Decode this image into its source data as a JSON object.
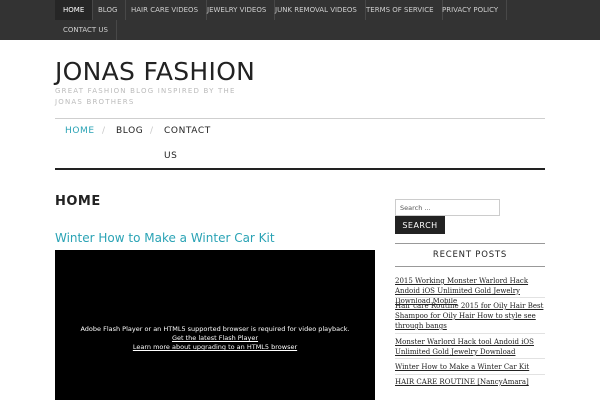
{
  "topnav": {
    "items": [
      {
        "label": "HOME",
        "active": true
      },
      {
        "label": "BLOG"
      },
      {
        "label": "HAIR CARE VIDEOS"
      },
      {
        "label": "JEWELRY VIDEOS"
      },
      {
        "label": "JUNK REMOVAL VIDEOS"
      },
      {
        "label": "TERMS OF SERVICE"
      },
      {
        "label": "PRIVACY POLICY"
      },
      {
        "label": "CONTACT US"
      }
    ]
  },
  "header": {
    "title": "JONAS FASHION",
    "description": "GREAT FASHION BLOG INSPIRED BY THE JONAS BROTHERS"
  },
  "mainnav": {
    "items": [
      {
        "label": "HOME",
        "active": true
      },
      {
        "label": "BLOG"
      },
      {
        "label": "CONTACT"
      },
      {
        "label": "US"
      }
    ],
    "separator": "/"
  },
  "content": {
    "page_title": "HOME",
    "post_title": "Winter How to Make a Winter Car Kit",
    "video": {
      "message": "Adobe Flash Player or an HTML5 supported browser is required for video playback.",
      "link1": "Get the latest Flash Player",
      "link2": "Learn more about upgrading to an HTML5 browser"
    }
  },
  "sidebar": {
    "search_placeholder": "Search ...",
    "search_button": "SEARCH",
    "recent_title": "RECENT POSTS",
    "recent_posts": [
      "2015 Working Monster Warlord Hack Andoid iOS Unlimited Gold Jewelry Download Mobile",
      "Hair care Routine 2015 for Oily Hair Best Shampoo for Oily Hair How to style see through bangs",
      "Monster Warlord Hack tool Andoid iOS Unlimited Gold Jewelry Download",
      "Winter How to Make a Winter Car Kit",
      "HAIR CARE ROUTINE [NancyAmara]"
    ]
  },
  "colors": {
    "accent": "#2aa3b5",
    "topbar": "#333333",
    "active_top": "#262626"
  }
}
